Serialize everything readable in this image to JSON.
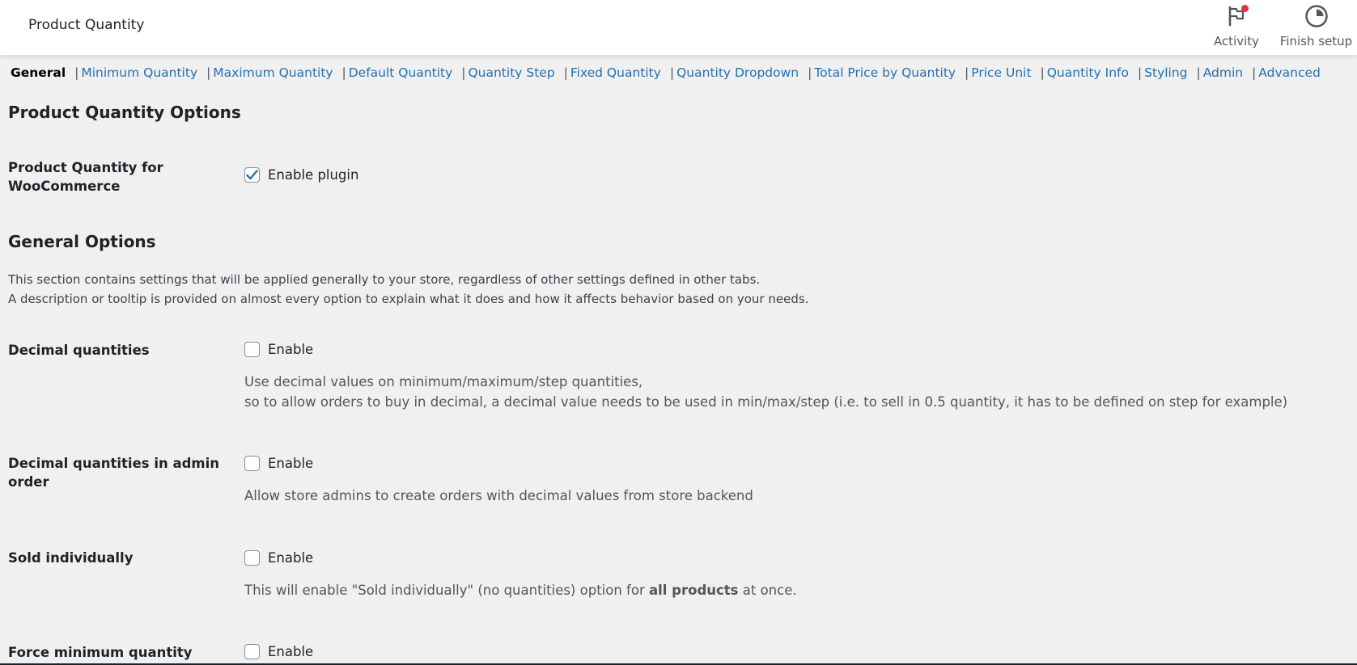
{
  "header": {
    "title": "Product Quantity",
    "activity_label": "Activity",
    "finish_setup_label": "Finish setup"
  },
  "tabs": [
    {
      "label": "General",
      "current": true
    },
    {
      "label": "Minimum Quantity"
    },
    {
      "label": "Maximum Quantity"
    },
    {
      "label": "Default Quantity"
    },
    {
      "label": "Quantity Step"
    },
    {
      "label": "Fixed Quantity"
    },
    {
      "label": "Quantity Dropdown"
    },
    {
      "label": "Total Price by Quantity"
    },
    {
      "label": "Price Unit"
    },
    {
      "label": "Quantity Info"
    },
    {
      "label": "Styling"
    },
    {
      "label": "Admin"
    },
    {
      "label": "Advanced"
    }
  ],
  "product_options": {
    "heading": "Product Quantity Options",
    "plugin_label_line1": "Product Quantity for",
    "plugin_label_line2": "WooCommerce",
    "enable_plugin_label": "Enable plugin",
    "enable_plugin_checked": true
  },
  "general_options": {
    "heading": "General Options",
    "intro_line1": "This section contains settings that will be applied generally to your store, regardless of other settings defined in other tabs.",
    "intro_line2": "A description or tooltip is provided on almost every option to explain what it does and how it affects behavior based on your needs.",
    "decimal": {
      "label": "Decimal quantities",
      "enable_label": "Enable",
      "checked": false,
      "desc_line1": "Use decimal values on minimum/maximum/step quantities,",
      "desc_line2": "so to allow orders to buy in decimal, a decimal value needs to be used in min/max/step (i.e. to sell in 0.5 quantity, it has to be defined on step for example)"
    },
    "decimal_admin": {
      "label_line1": "Decimal quantities in admin",
      "label_line2": "order",
      "enable_label": "Enable",
      "checked": false,
      "desc": "Allow store admins to create orders with decimal values from store backend"
    },
    "sold_individually": {
      "label": "Sold individually",
      "enable_label": "Enable",
      "checked": false,
      "desc_prefix": "This will enable \"Sold individually\" (no quantities) option for ",
      "desc_bold": "all products",
      "desc_suffix": " at once."
    },
    "force_min": {
      "label": "Force minimum quantity",
      "enable_label": "Enable",
      "checked": false
    }
  },
  "colors": {
    "link": "#2271b1",
    "background": "#f0f0f1",
    "notification_dot": "#d63638"
  }
}
